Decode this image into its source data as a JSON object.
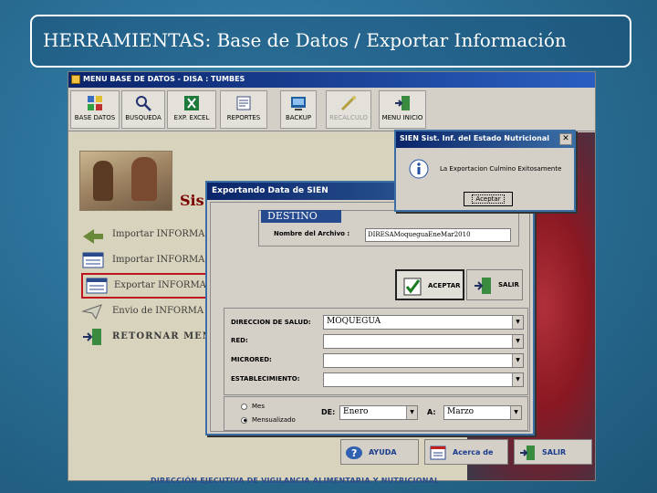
{
  "slide": {
    "title": "HERRAMIENTAS: Base de Datos / Exportar Información",
    "footer": "DIRECCIÓN EJECUTIVA DE VIGILANCIA ALIMENTARIA Y NUTRICIONAL"
  },
  "app": {
    "title": "MENU BASE DE DATOS -  DISA : TUMBES",
    "toolbar": [
      {
        "label": "BASE DATOS",
        "icon": "database-icon"
      },
      {
        "label": "BUSQUEDA",
        "icon": "search-icon"
      },
      {
        "label": "EXP. EXCEL",
        "icon": "excel-icon"
      },
      {
        "label": "REPORTES",
        "icon": "reports-icon"
      },
      {
        "label": "BACKUP",
        "icon": "backup-icon"
      },
      {
        "label": "RECALCULO",
        "icon": "recalc-icon",
        "disabled": true
      },
      {
        "label": "MENU INICIO",
        "icon": "exit-door-icon"
      }
    ],
    "heading_partial": "Sis",
    "menu": [
      {
        "label": "Importar INFORMA",
        "icon": "import-icon"
      },
      {
        "label": "Importar INFORMA",
        "icon": "import-list-icon"
      },
      {
        "label": "Exportar INFORMA",
        "icon": "export-icon",
        "selected": true
      },
      {
        "label": "Envio de INFORMA",
        "icon": "send-icon"
      },
      {
        "label": "RETORNAR MENU",
        "icon": "return-icon"
      }
    ],
    "bottom_buttons": [
      {
        "label": "AYUDA",
        "icon": "help-icon"
      },
      {
        "label": "Acerca de",
        "icon": "about-icon"
      },
      {
        "label": "SALIR",
        "icon": "exit-icon"
      }
    ]
  },
  "export_dialog": {
    "title": "Exportando Data de SIEN",
    "destino_label": "DESTINO",
    "file_name_label": "Nombre del Archivo :",
    "file_name_value": "DIRESAMoqueguaEneMar2010",
    "accept_label": "ACEPTAR",
    "exit_label": "SALIR",
    "fields": [
      {
        "label": "DIRECCION DE SALUD:",
        "value": "MOQUEGUA"
      },
      {
        "label": "RED:",
        "value": ""
      },
      {
        "label": "MICRORED:",
        "value": ""
      },
      {
        "label": "ESTABLECIMIENTO:",
        "value": ""
      }
    ],
    "period": {
      "option_month": "Mes",
      "option_range": "Mensualizado",
      "selected": "Mensualizado",
      "from_label": "DE:",
      "from_value": "Enero",
      "to_label": "A:",
      "to_value": "Marzo"
    }
  },
  "message_box": {
    "title": "SIEN Sist. Inf. del Estado Nutricional",
    "close_label": "✕",
    "text": "La Exportacion Culmino Exitosamente",
    "ok_label": "Aceptar"
  }
}
